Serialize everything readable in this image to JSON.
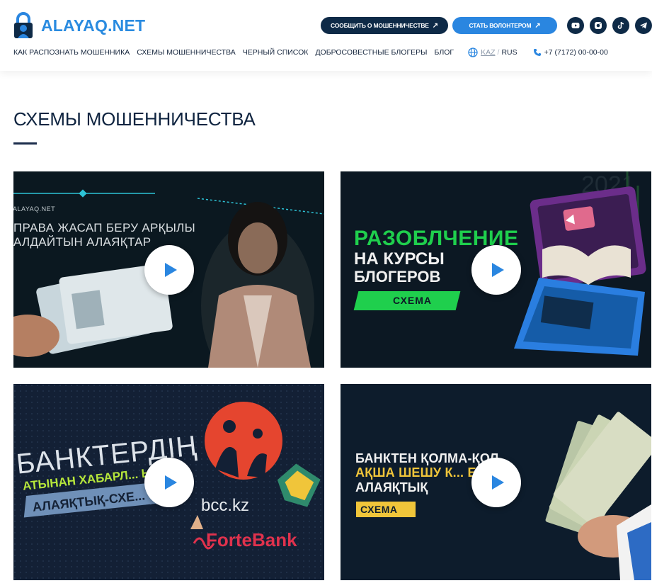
{
  "header": {
    "logo_text": "ALAYAQ.NET",
    "report_button": "СООБЩИТЬ О МОШЕННИЧЕСТВЕ",
    "volunteer_button": "СТАТЬ ВОЛОНТЕРОМ",
    "arrow": "↗",
    "social": [
      "youtube-icon",
      "instagram-icon",
      "tiktok-icon",
      "telegram-icon"
    ]
  },
  "nav": {
    "items": [
      {
        "label": "КАК РАСПОЗНАТЬ МОШЕННИКА"
      },
      {
        "label": "СХЕМЫ МОШЕННИЧЕСТВА"
      },
      {
        "label": "ЧЕРНЫЙ СПИСОК"
      },
      {
        "label": "ДОБРОСОВЕСТНЫЕ БЛОГЕРЫ"
      },
      {
        "label": "БЛОГ"
      }
    ],
    "lang_kaz": "KAZ",
    "lang_sep": "/",
    "lang_rus": "RUS",
    "phone": "+7 (7172) 00-00-00"
  },
  "page": {
    "title": "СХЕМЫ МОШЕННИЧЕСТВА"
  },
  "videos": [
    {
      "brand": "ALAYAQ.NET",
      "line1": "ПРАВА ЖАСАП БЕРУ АРҚЫЛЫ",
      "line2": "АЛДАЙТЫН АЛАЯҚТАР"
    },
    {
      "line1": "РАЗОБЛЧЕНИЕ",
      "line2": "НА КУРСЫ",
      "line3": "БЛОГЕРОВ",
      "badge": "СХЕМА"
    },
    {
      "line1": "БАНКТЕРДІҢ",
      "line2": "АТЫНАН ХАБАРЛ... ЫН",
      "badge": "АЛАЯҚТЫҚ-СХЕ...",
      "logo1": "bcc.kz",
      "logo2": "ForteBank"
    },
    {
      "line1": "БАНКТЕН ҚОЛМА-ҚОЛ",
      "line2": "АҚША ШЕШУ К... ЕГІ",
      "line3": "АЛАЯҚТЫҚ",
      "badge": "СХЕМА"
    }
  ],
  "colors": {
    "navy": "#0e2a47",
    "blue": "#2a86e0",
    "green": "#1fcf4d",
    "yellow": "#f0c53a",
    "forte_red": "#e0324d"
  }
}
